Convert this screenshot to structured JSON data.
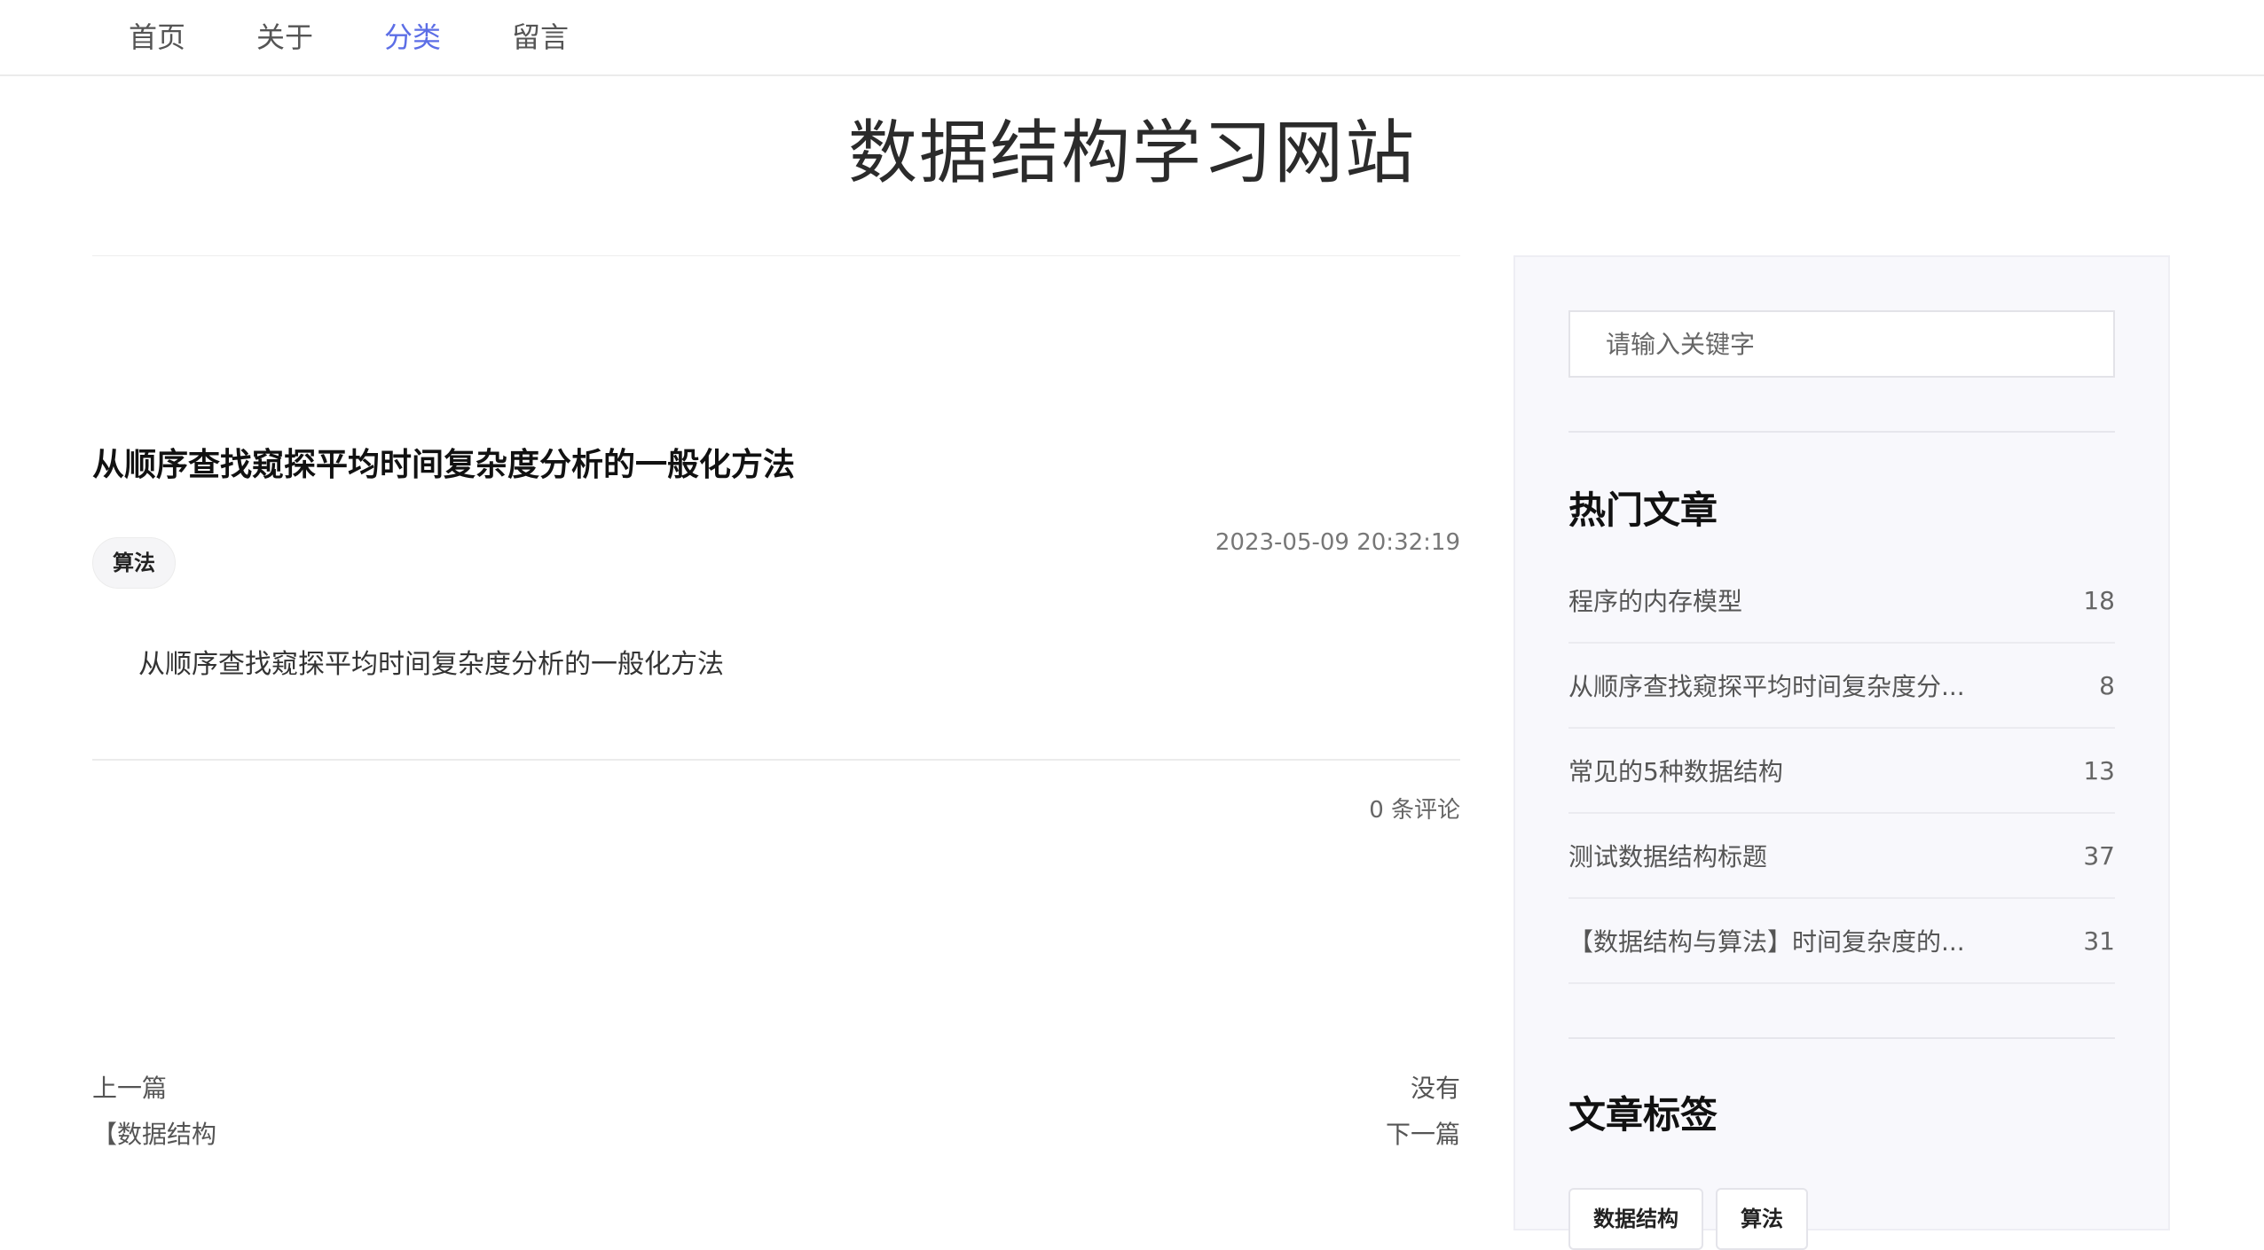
{
  "nav": {
    "items": [
      {
        "label": "首页"
      },
      {
        "label": "关于"
      },
      {
        "label": "分类"
      },
      {
        "label": "留言"
      }
    ]
  },
  "site": {
    "title": "数据结构学习网站"
  },
  "post": {
    "title": "从顺序查找窥探平均时间复杂度分析的一般化方法",
    "date": "2023-05-09 20:32:19",
    "tag": "算法",
    "summary": "从顺序查找窥探平均时间复杂度分析的一般化方法",
    "comments": "0 条评论"
  },
  "pager": {
    "prev_label": "上一篇",
    "prev_title": "【数据结构",
    "next_title": "没有",
    "next_label": "下一篇"
  },
  "sidebar": {
    "search_placeholder": "请输入关键字",
    "hot_heading": "热门文章",
    "hot": [
      {
        "title": "程序的内存模型",
        "count": "18"
      },
      {
        "title": "从顺序查找窥探平均时间复杂度分...",
        "count": "8"
      },
      {
        "title": "常见的5种数据结构",
        "count": "13"
      },
      {
        "title": "测试数据结构标题",
        "count": "37"
      },
      {
        "title": "【数据结构与算法】时间复杂度的...",
        "count": "31"
      }
    ],
    "tags_heading": "文章标签",
    "tags": [
      "数据结构",
      "算法"
    ]
  },
  "colors": {
    "accent": "#5c6ee6",
    "sidebar_bg": "#f8f8fc"
  }
}
